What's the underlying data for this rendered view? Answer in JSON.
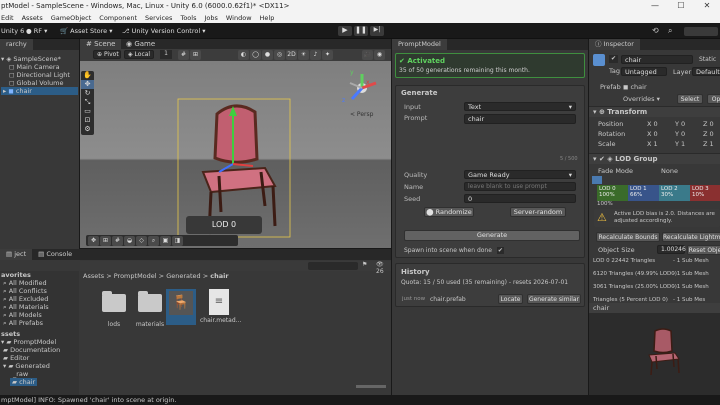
{
  "window": {
    "title": "ptModel - SampleScene - Windows, Mac, Linux - Unity 6.0 (6000.0.62f1)* <DX11>",
    "min": "—",
    "max": "☐",
    "close": "✕"
  },
  "menu": [
    "Edit",
    "Assets",
    "GameObject",
    "Component",
    "Services",
    "Tools",
    "Jobs",
    "Window",
    "Help"
  ],
  "toolbar": {
    "unity": "Unity 6",
    "account": "RF",
    "asset_store": "Asset Store",
    "vcs": "Unity Version Control"
  },
  "hierarchy": {
    "tab": "rarchy",
    "items": [
      "SampleScene*",
      "Main Camera",
      "Directional Light",
      "Global Volume",
      "chair"
    ]
  },
  "scene": {
    "tabs": [
      "Scene",
      "Game"
    ],
    "pivot": "Pivot",
    "local": "Local",
    "grid_count": "1",
    "persp": "< Persp",
    "lod_label": "LOD 0",
    "axes": [
      "y",
      "x",
      "z"
    ]
  },
  "project": {
    "tabs": [
      "ject",
      "Console"
    ],
    "count": "26",
    "breadcrumb": [
      "Assets",
      "PromptModel",
      "Generated",
      "chair"
    ],
    "tree_favorites_header": "avorites",
    "favorites": [
      "All Modified",
      "All Conflicts",
      "All Excluded",
      "All Materials",
      "All Models",
      "All Prefabs"
    ],
    "tree_assets_header": "ssets",
    "tree": [
      "PromptModel",
      "Documentation",
      "Editor",
      "Generated",
      "_raw",
      "chair"
    ],
    "files": [
      "lods",
      "materials",
      "",
      "chair.metad..."
    ]
  },
  "status": {
    "text": "mptModel] INFO: Spawned 'chair' into scene at origin."
  },
  "prompt_model": {
    "tab": "PromptModel",
    "activated_title": "Activated",
    "activated_sub": "35 of 50 generations remaining this month.",
    "generate_header": "Generate",
    "input_label": "Input",
    "input_value": "Text",
    "prompt_label": "Prompt",
    "prompt_value": "chair",
    "char_count": "5 / 500",
    "quality_label": "Quality",
    "quality_value": "Game Ready",
    "name_label": "Name",
    "name_placeholder": "leave blank to use prompt",
    "seed_label": "Seed",
    "seed_value": "0",
    "randomize": "Randomize",
    "server_random": "Server-random",
    "generate_btn": "Generate",
    "spawn_label": "Spawn into scene when done",
    "history_header": "History",
    "quota": "Quota: 15 / 50 used (35 remaining) - resets 2026-07-01",
    "hist_time": "just now",
    "hist_file": "chair.prefab",
    "locate": "Locate",
    "generate_similar": "Generate similar"
  },
  "inspector": {
    "tab": "Inspector",
    "name": "chair",
    "static": "Static",
    "tag_label": "Tag",
    "tag": "Untagged",
    "layer_label": "Layer",
    "layer": "Default",
    "prefab_label": "Prefab",
    "prefab": "chair",
    "overrides": "Overrides",
    "select": "Select",
    "open": "Op",
    "transform": "Transform",
    "position": "Position",
    "rotation": "Rotation",
    "scale": "Scale",
    "pos": [
      "0",
      "0",
      "0"
    ],
    "rot": [
      "0",
      "0",
      "0"
    ],
    "scl": [
      "1",
      "1",
      "1"
    ],
    "lod_group": "LOD Group",
    "fade_label": "Fade Mode",
    "fade": "None",
    "lods": [
      {
        "name": "LOD 0",
        "pct": "100%",
        "color": "#3a6b2a"
      },
      {
        "name": "LOD 1",
        "pct": "66%",
        "color": "#38548a"
      },
      {
        "name": "LOD 2",
        "pct": "30%",
        "color": "#3a7a8a"
      },
      {
        "name": "LOD 3",
        "pct": "10%",
        "color": "#8a3030"
      }
    ],
    "below_pct": "100%",
    "warning": "Active LOD bias is 2.0. Distances are adjusted accordingly.",
    "recalc_bounds": "Recalculate Bounds",
    "recalc_lightmap": "Recalculate Lightma",
    "object_size_label": "Object Size",
    "object_size": "1.00246",
    "reset_object": "Reset Obje",
    "lod_rows": [
      {
        "tris": "LOD 0  22442 Triangles",
        "sub": "- 1 Sub Mesh"
      },
      {
        "tris": "6120 Triangles  (49.99% LOD0)",
        "sub": "- 1 Sub Mesh"
      },
      {
        "tris": "3061 Triangles  (25.00% LOD0)",
        "sub": "- 1 Sub Mesh"
      }
    ],
    "truncated_row": "Triangles  (5 Percent LOD 0)",
    "truncated_sub": "- 1 Sub Mes",
    "preview_label": "chair"
  }
}
